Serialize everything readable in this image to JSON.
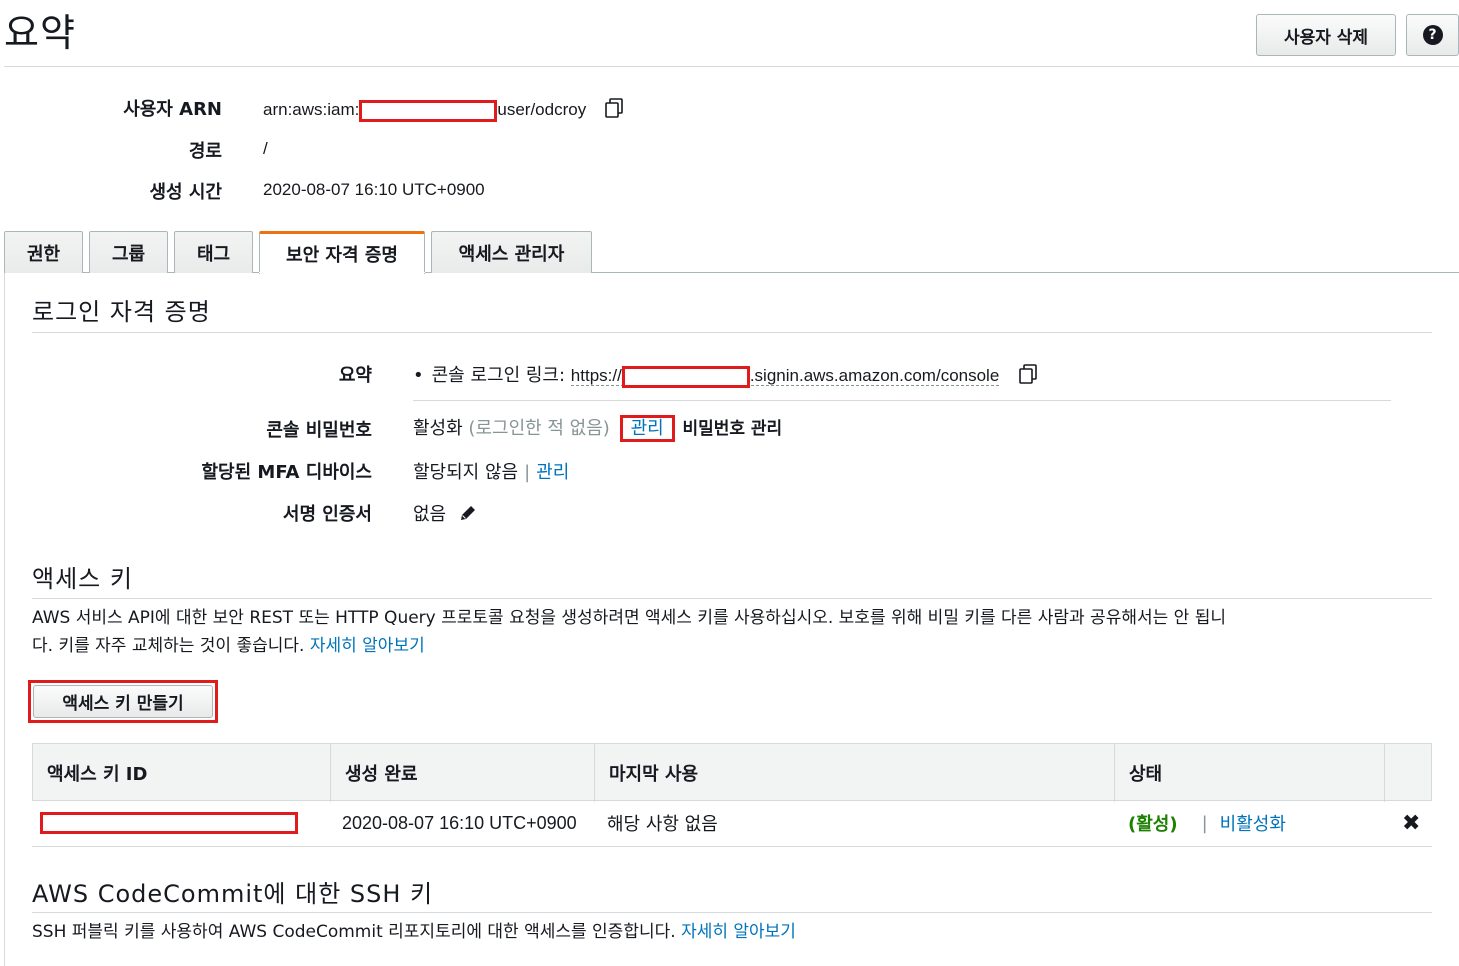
{
  "header": {
    "title": "요약",
    "delete_user_label": "사용자 삭제",
    "help_label": "?"
  },
  "summary": {
    "arn_label": "사용자 ARN",
    "arn_prefix": "arn:aws:iam:",
    "arn_suffix": "user/odcroy",
    "path_label": "경로",
    "path_value": "/",
    "created_label": "생성 시간",
    "created_value": "2020-08-07 16:10 UTC+0900"
  },
  "tabs": [
    {
      "label": "권한"
    },
    {
      "label": "그룹"
    },
    {
      "label": "태그"
    },
    {
      "label": "보안 자격 증명",
      "active": true
    },
    {
      "label": "액세스 관리자"
    }
  ],
  "login_credentials": {
    "title": "로그인 자격 증명",
    "summary_label": "요약",
    "console_link_label": "콘솔 로그인 링크:",
    "console_link_prefix": "https://",
    "console_link_suffix": ".signin.aws.amazon.com/console",
    "console_password_label": "콘솔 비밀번호",
    "console_password_status": "활성화",
    "console_password_note": "(로그인한 적 없음)",
    "console_password_manage": "관리",
    "console_password_annotation": "비밀번호 관리",
    "mfa_label": "할당된 MFA 디바이스",
    "mfa_value": "할당되지 않음",
    "mfa_manage": "관리",
    "signing_cert_label": "서명 인증서",
    "signing_cert_value": "없음"
  },
  "access_keys": {
    "title": "액세스 키",
    "description_line1": "AWS 서비스 API에 대한 보안 REST 또는 HTTP Query 프로토콜 요청을 생성하려면 액세스 키를 사용하십시오. 보호를 위해 비밀 키를 다른 사람과 공유해서는 안 됩니",
    "description_line2": "다. 키를 자주 교체하는 것이 좋습니다.",
    "learn_more": "자세히 알아보기",
    "create_button": "액세스 키 만들기",
    "columns": [
      "액세스 키 ID",
      "생성 완료",
      "마지막 사용",
      "상태"
    ],
    "rows": [
      {
        "created": "2020-08-07 16:10 UTC+0900",
        "last_used": "해당 사항 없음",
        "status": "(활성)",
        "action": "비활성화"
      }
    ]
  },
  "codecommit": {
    "title": "AWS CodeCommit에 대한 SSH 키",
    "description": "SSH 퍼블릭 키를 사용하여 AWS CodeCommit 리포지토리에 대한 액세스를 인증합니다.",
    "learn_more": "자세히 알아보기"
  }
}
